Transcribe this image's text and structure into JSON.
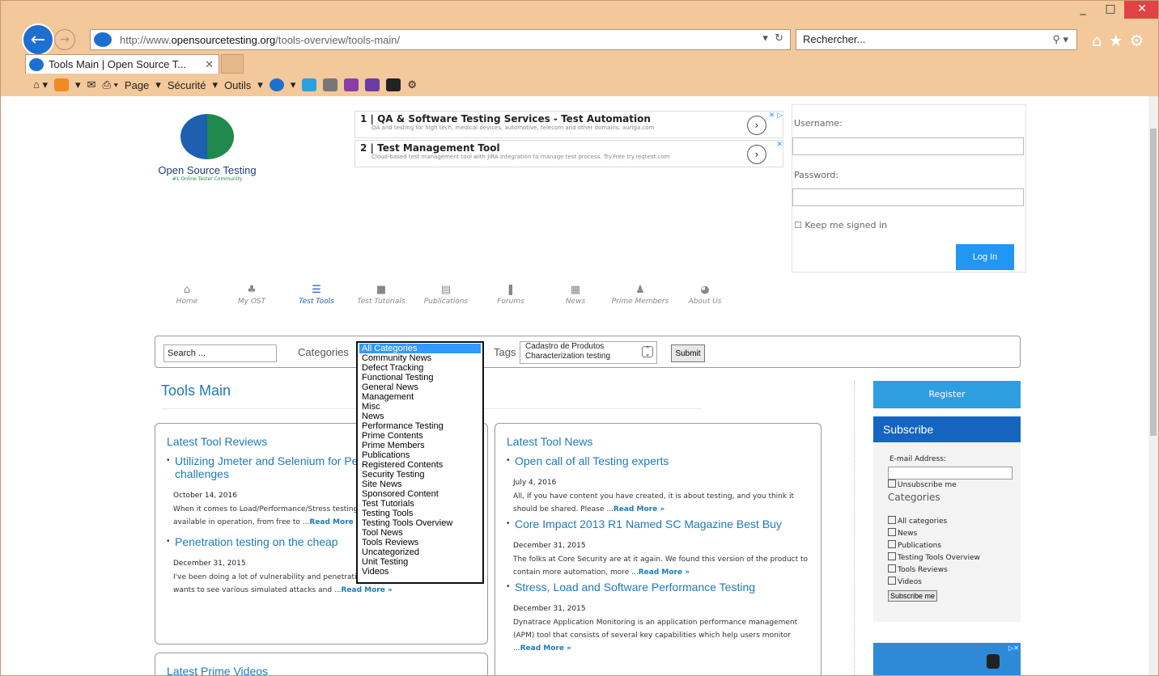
{
  "browser": {
    "url_prefix": "http://www.",
    "url_domain": "opensourcetesting.org",
    "url_path": "/tools-overview/tools-main/",
    "search_placeholder": "Rechercher...",
    "tab_title": "Tools Main | Open Source T...",
    "commandbar": [
      "Page",
      "Sécurité",
      "Outils"
    ]
  },
  "site": {
    "logo_name": "Open Source Testing",
    "logo_tagline": "#1 Online Tester Community",
    "ads": [
      {
        "num": "1",
        "title": "QA & Software Testing Services - Test Automation",
        "desc": "QA and testing for high tech, medical devices, automotive, telecom and other domains. auriga.com"
      },
      {
        "num": "2",
        "title": "Test Management Tool",
        "desc": "Cloud-based test management tool with JIRA integration to manage test process. Try.Free try.reqtest.com"
      }
    ],
    "login": {
      "username_label": "Username:",
      "password_label": "Password:",
      "keep": "Keep me signed in",
      "login_button": "Log In"
    },
    "nav": [
      {
        "label": "Home",
        "glyph": "⌂"
      },
      {
        "label": "My OST",
        "glyph": "♣"
      },
      {
        "label": "Test Tools",
        "glyph": "☰"
      },
      {
        "label": "Test Tutorials",
        "glyph": "■"
      },
      {
        "label": "Publications",
        "glyph": "▤"
      },
      {
        "label": "Forums",
        "glyph": "❚"
      },
      {
        "label": "News",
        "glyph": "▦"
      },
      {
        "label": "Prime Members",
        "glyph": "♟"
      },
      {
        "label": "About Us",
        "glyph": "◕"
      }
    ],
    "searchbar": {
      "search_value": "Search ...",
      "categories_label": "Categories",
      "tags_label": "Tags",
      "tags_values": [
        "Cadastro de Produtos",
        "Characterization testing"
      ],
      "submit": "Submit"
    },
    "categories_options": [
      "All Categories",
      "Community News",
      "Defect Tracking",
      "Functional Testing",
      "General News",
      "Management",
      "Misc",
      "News",
      "Performance Testing",
      "Prime Contents",
      "Prime Members",
      "Publications",
      "Registered Contents",
      "Security Testing",
      "Site News",
      "Sponsored Content",
      "Test Tutorials",
      "Testing Tools",
      "Testing Tools Overview",
      "Tool News",
      "Tools Reviews",
      "Uncategorized",
      "Unit Testing",
      "Videos"
    ],
    "page_title": "Tools Main",
    "reviews": {
      "heading": "Latest Tool Reviews",
      "posts": [
        {
          "title": "Utilizing Jmeter and Selenium for Performance Testing challenges",
          "date": "October 14, 2016",
          "excerpt": "When it comes to Load/Performance/Stress testing there are numerous testing tools available in operation, from free to ...",
          "more": "Read More »"
        },
        {
          "title": "Penetration testing on the cheap",
          "date": "December 31, 2015",
          "excerpt": "I've been doing a lot of vulnerability and penetration testingfor a customer who wants to see various simulated attacks and ...",
          "more": "Read More »"
        }
      ]
    },
    "news": {
      "heading": "Latest Tool News",
      "posts": [
        {
          "title": "Open call of all Testing experts",
          "date": "July 4, 2016",
          "excerpt": "All, If you have content you have created, it is about testing, and you think it should be shared. Please ...",
          "more": "Read More »"
        },
        {
          "title": "Core Impact 2013 R1 Named SC Magazine Best Buy",
          "date": "December 31, 2015",
          "excerpt": "The folks at Core Security are at it again. We found this version of the product to contain more automation, more ...",
          "more": "Read More »"
        },
        {
          "title": "Stress, Load and Software Performance Testing",
          "date": "December 31, 2015",
          "excerpt": "Dynatrace Application Monitoring is an application performance management (APM) tool that consists of several key capabilities which help users monitor ...",
          "more": "Read More »"
        }
      ]
    },
    "videos_heading": "Latest Prime Videos",
    "sidebar": {
      "register": "Register",
      "subscribe_heading": "Subscribe",
      "email_label": "E-mail Address:",
      "unsubscribe": "Unsubscribe me",
      "categories_heading": "Categories",
      "cats": [
        "All categories",
        "News",
        "Publications",
        "Testing Tools Overview",
        "Tools Reviews",
        "Videos"
      ],
      "subscribe_button": "Subscribe me"
    }
  }
}
